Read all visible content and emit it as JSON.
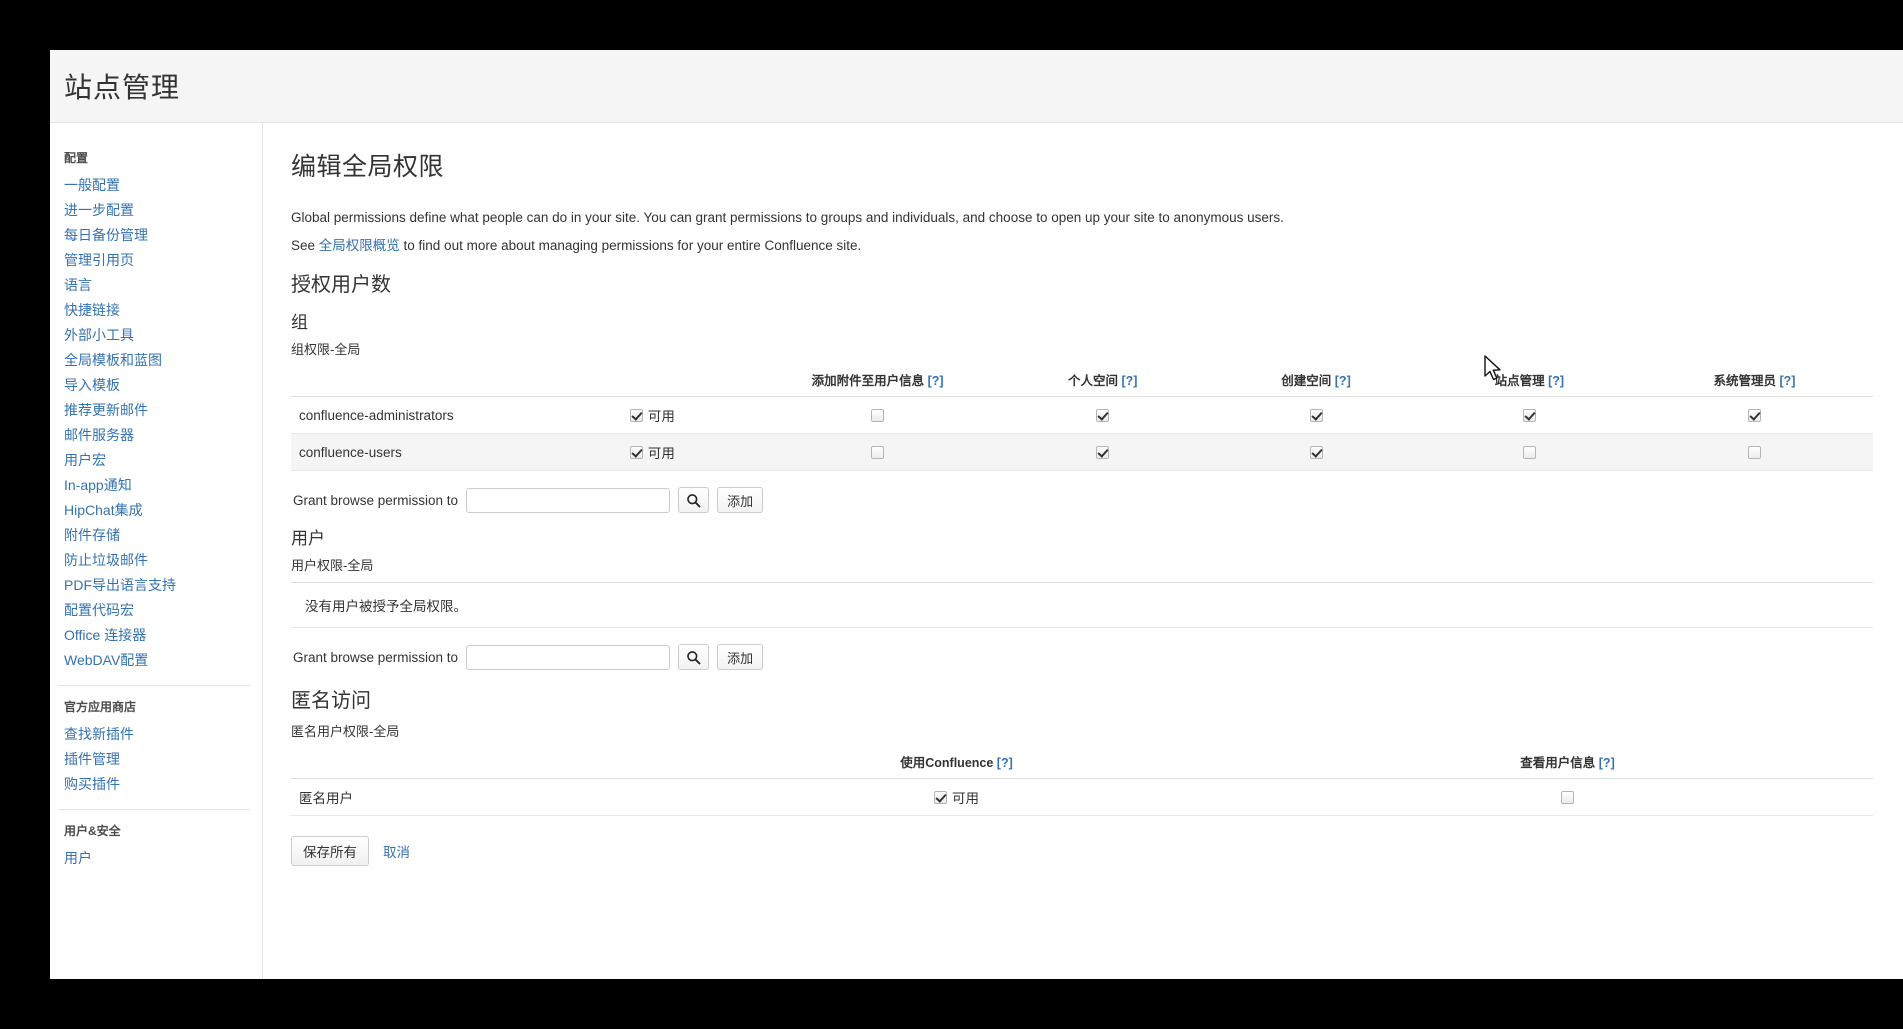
{
  "header": {
    "title": "站点管理"
  },
  "sidebar": {
    "groups": [
      {
        "title": "配置",
        "items": [
          {
            "label": "一般配置"
          },
          {
            "label": "进一步配置"
          },
          {
            "label": "每日备份管理"
          },
          {
            "label": "管理引用页"
          },
          {
            "label": "语言"
          },
          {
            "label": "快捷链接"
          },
          {
            "label": "外部小工具"
          },
          {
            "label": "全局模板和蓝图"
          },
          {
            "label": "导入模板"
          },
          {
            "label": "推荐更新邮件"
          },
          {
            "label": "邮件服务器"
          },
          {
            "label": "用户宏"
          },
          {
            "label": "In-app通知"
          },
          {
            "label": "HipChat集成"
          },
          {
            "label": "附件存储"
          },
          {
            "label": "防止垃圾邮件"
          },
          {
            "label": "PDF导出语言支持"
          },
          {
            "label": "配置代码宏"
          },
          {
            "label": "Office 连接器"
          },
          {
            "label": "WebDAV配置"
          }
        ]
      },
      {
        "title": "官方应用商店",
        "items": [
          {
            "label": "查找新插件"
          },
          {
            "label": "插件管理"
          },
          {
            "label": "购买插件"
          }
        ]
      },
      {
        "title": "用户&安全",
        "items": [
          {
            "label": "用户"
          }
        ]
      }
    ]
  },
  "main": {
    "title": "编辑全局权限",
    "intro_line1": "Global permissions define what people can do in your site. You can grant permissions to groups and individuals, and choose to open up your site to anonymous users.",
    "intro_see_prefix": "See ",
    "intro_link": "全局权限概览",
    "intro_see_suffix": " to find out more about managing permissions for your entire Confluence site.",
    "licensed_users_heading": "授权用户数",
    "groups_heading": "组",
    "groups_caption": "组权限-全局",
    "groups_table": {
      "headers": [
        {
          "label": "",
          "help": ""
        },
        {
          "label": "",
          "help": ""
        },
        {
          "label": "添加附件至用户信息",
          "help": "[?]"
        },
        {
          "label": "个人空间",
          "help": "[?]"
        },
        {
          "label": "创建空间",
          "help": "[?]"
        },
        {
          "label": "站点管理",
          "help": "[?]"
        },
        {
          "label": "系统管理员",
          "help": "[?]"
        }
      ],
      "enabled_label": "可用",
      "rows": [
        {
          "name": "confluence-administrators",
          "use_confluence": true,
          "permissions": [
            false,
            true,
            true,
            true,
            true
          ]
        },
        {
          "name": "confluence-users",
          "use_confluence": true,
          "permissions": [
            false,
            true,
            true,
            false,
            false
          ]
        }
      ]
    },
    "grant_group": {
      "label": "Grant browse permission to",
      "value": "",
      "placeholder": "",
      "search_icon": "search-icon",
      "add_label": "添加"
    },
    "users_heading": "用户",
    "users_caption": "用户权限-全局",
    "users_empty": "没有用户被授予全局权限。",
    "grant_user": {
      "label": "Grant browse permission to",
      "value": "",
      "placeholder": "",
      "search_icon": "search-icon",
      "add_label": "添加"
    },
    "anonymous_heading": "匿名访问",
    "anonymous_caption": "匿名用户权限-全局",
    "anonymous_table": {
      "headers": [
        {
          "label": "",
          "help": ""
        },
        {
          "label": "使用Confluence",
          "help": "[?]"
        },
        {
          "label": "查看用户信息",
          "help": "[?]"
        }
      ],
      "enabled_label": "可用",
      "rows": [
        {
          "name": "匿名用户",
          "use_confluence": true,
          "view_user_profiles": false
        }
      ]
    },
    "save_label": "保存所有",
    "cancel_label": "取消"
  },
  "colors": {
    "link": "#3572b0",
    "annotation_arrow": "#d81e05",
    "header_bg": "#f5f5f5"
  }
}
